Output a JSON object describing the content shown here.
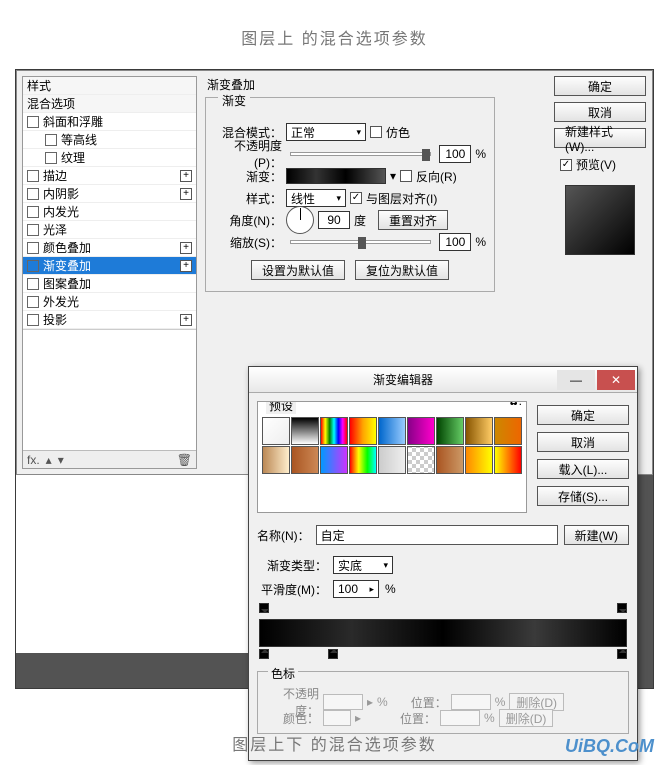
{
  "page": {
    "title_top": "图层上   的混合选项参数",
    "title_bottom": "图层上下  的混合选项参数",
    "watermark": "UiBQ.CoM"
  },
  "styles_panel": {
    "header_styles": "样式",
    "header_blend": "混合选项",
    "items": [
      {
        "label": "斜面和浮雕",
        "cb": true,
        "plus": false
      },
      {
        "label": "等高线",
        "cb": true,
        "indent": true
      },
      {
        "label": "纹理",
        "cb": true,
        "indent": true
      },
      {
        "label": "描边",
        "cb": true,
        "plus": true
      },
      {
        "label": "内阴影",
        "cb": true,
        "plus": true
      },
      {
        "label": "内发光",
        "cb": true
      },
      {
        "label": "光泽",
        "cb": true
      },
      {
        "label": "颜色叠加",
        "cb": true,
        "plus": true
      },
      {
        "label": "渐变叠加",
        "cb": true,
        "checked": true,
        "plus": true,
        "sel": true
      },
      {
        "label": "图案叠加",
        "cb": true
      },
      {
        "label": "外发光",
        "cb": true
      },
      {
        "label": "投影",
        "cb": true,
        "plus": true
      }
    ],
    "fx_label": "fx."
  },
  "grad_overlay": {
    "group_title": "渐变叠加",
    "inner_title": "渐变",
    "mode_label": "混合模式：",
    "mode_value": "正常",
    "dither_label": "仿色",
    "opacity_label": "不透明度(P)：",
    "opacity_value": "100",
    "pct": "%",
    "gradient_label": "渐变：",
    "reverse_label": "反向(R)",
    "style_label": "样式：",
    "style_value": "线性",
    "align_label": "与图层对齐(I)",
    "angle_label": "角度(N)：",
    "angle_value": "90",
    "degree": "度",
    "reset_align": "重置对齐",
    "scale_label": "缩放(S)：",
    "scale_value": "100",
    "make_default": "设置为默认值",
    "reset_default": "复位为默认值"
  },
  "right_buttons": {
    "ok": "确定",
    "cancel": "取消",
    "new_style": "新建样式(W)...",
    "preview": "预览(V)"
  },
  "grad_editor": {
    "title": "渐变编辑器",
    "presets_label": "预设",
    "ok": "确定",
    "cancel": "取消",
    "load": "载入(L)...",
    "save": "存储(S)...",
    "name_label": "名称(N)：",
    "name_value": "自定",
    "new_btn": "新建(W)",
    "type_label": "渐变类型：",
    "type_value": "实底",
    "smooth_label": "平滑度(M)：",
    "smooth_value": "100",
    "stops_label": "色标",
    "opacity_label": "不透明度：",
    "position_label": "位置：",
    "color_label": "颜色：",
    "delete": "删除(D)",
    "pct": "%"
  },
  "swatches": [
    "linear-gradient(135deg,#fff,#eee)",
    "linear-gradient(#000,#fff)",
    "linear-gradient(90deg,red,yellow,green,cyan,blue,magenta,red)",
    "linear-gradient(90deg,red,orange,yellow)",
    "linear-gradient(90deg,#06c,#9cf)",
    "linear-gradient(90deg,#808,#f0c)",
    "linear-gradient(90deg,#040,#6c6)",
    "linear-gradient(90deg,#850,#fc6)",
    "linear-gradient(90deg,#c80,#e60)",
    "linear-gradient(90deg,#b85,#fec)",
    "linear-gradient(90deg,#a52,#c85)",
    "linear-gradient(90deg,#09f,#c3f)",
    "linear-gradient(90deg,red,yellow,lime,cyan)",
    "linear-gradient(90deg,#ccc,#eee)",
    "repeating-conic-gradient(#ccc 0 25%,#fff 0 50%) 0/8px 8px",
    "linear-gradient(90deg,#a52,#c96)",
    "linear-gradient(90deg,#f80,#ff0)",
    "linear-gradient(90deg,#ff0,#f00)"
  ]
}
